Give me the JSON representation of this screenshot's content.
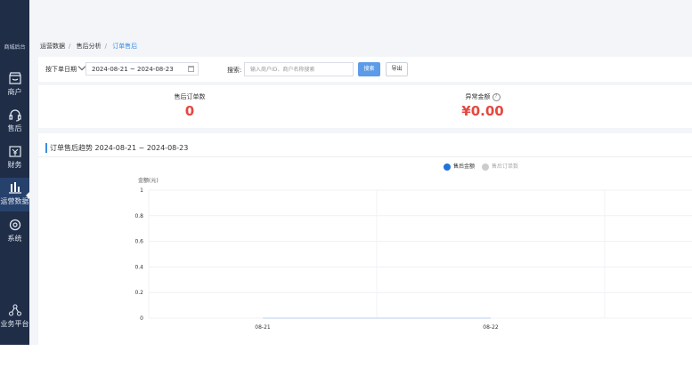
{
  "sidebar": {
    "logo": "商城后台",
    "items": [
      {
        "label": "商户"
      },
      {
        "label": "售后"
      },
      {
        "label": "财务"
      },
      {
        "label": "运营数据"
      },
      {
        "label": "系统"
      },
      {
        "label": "业务平台"
      }
    ]
  },
  "breadcrumb": [
    "运营数据",
    "售后分析",
    "订单售后"
  ],
  "filter": {
    "mode": "按下单日期",
    "date_range": "2024-08-21 ~ 2024-08-23",
    "search_label": "搜索:",
    "search_placeholder": "输入商户ID、商户名称搜索",
    "search_button": "搜索",
    "export_button": "导出"
  },
  "stats": {
    "orders_label": "售后订单数",
    "orders_value": "0",
    "amount_label": "异常金额",
    "amount_value": "¥0.00"
  },
  "chart_title": "订单售后趋势 2024-08-21 ~ 2024-08-23",
  "chart_data": {
    "type": "line",
    "title": "订单售后趋势 2024-08-21 ~ 2024-08-23",
    "ylabel": "金额(元)",
    "xlabel": "",
    "categories": [
      "08-21",
      "08-22"
    ],
    "yticks": [
      0,
      0.2,
      0.4,
      0.6,
      0.8,
      1
    ],
    "ylim": [
      0,
      1
    ],
    "legend_position": "top-right",
    "series": [
      {
        "name": "售后金额",
        "values": [
          0,
          0
        ],
        "active": true
      },
      {
        "name": "售后订单数",
        "values": [
          0,
          0
        ],
        "active": false
      }
    ],
    "colors": {
      "series1": "#1f73d9",
      "series2": "#cccccc"
    }
  }
}
